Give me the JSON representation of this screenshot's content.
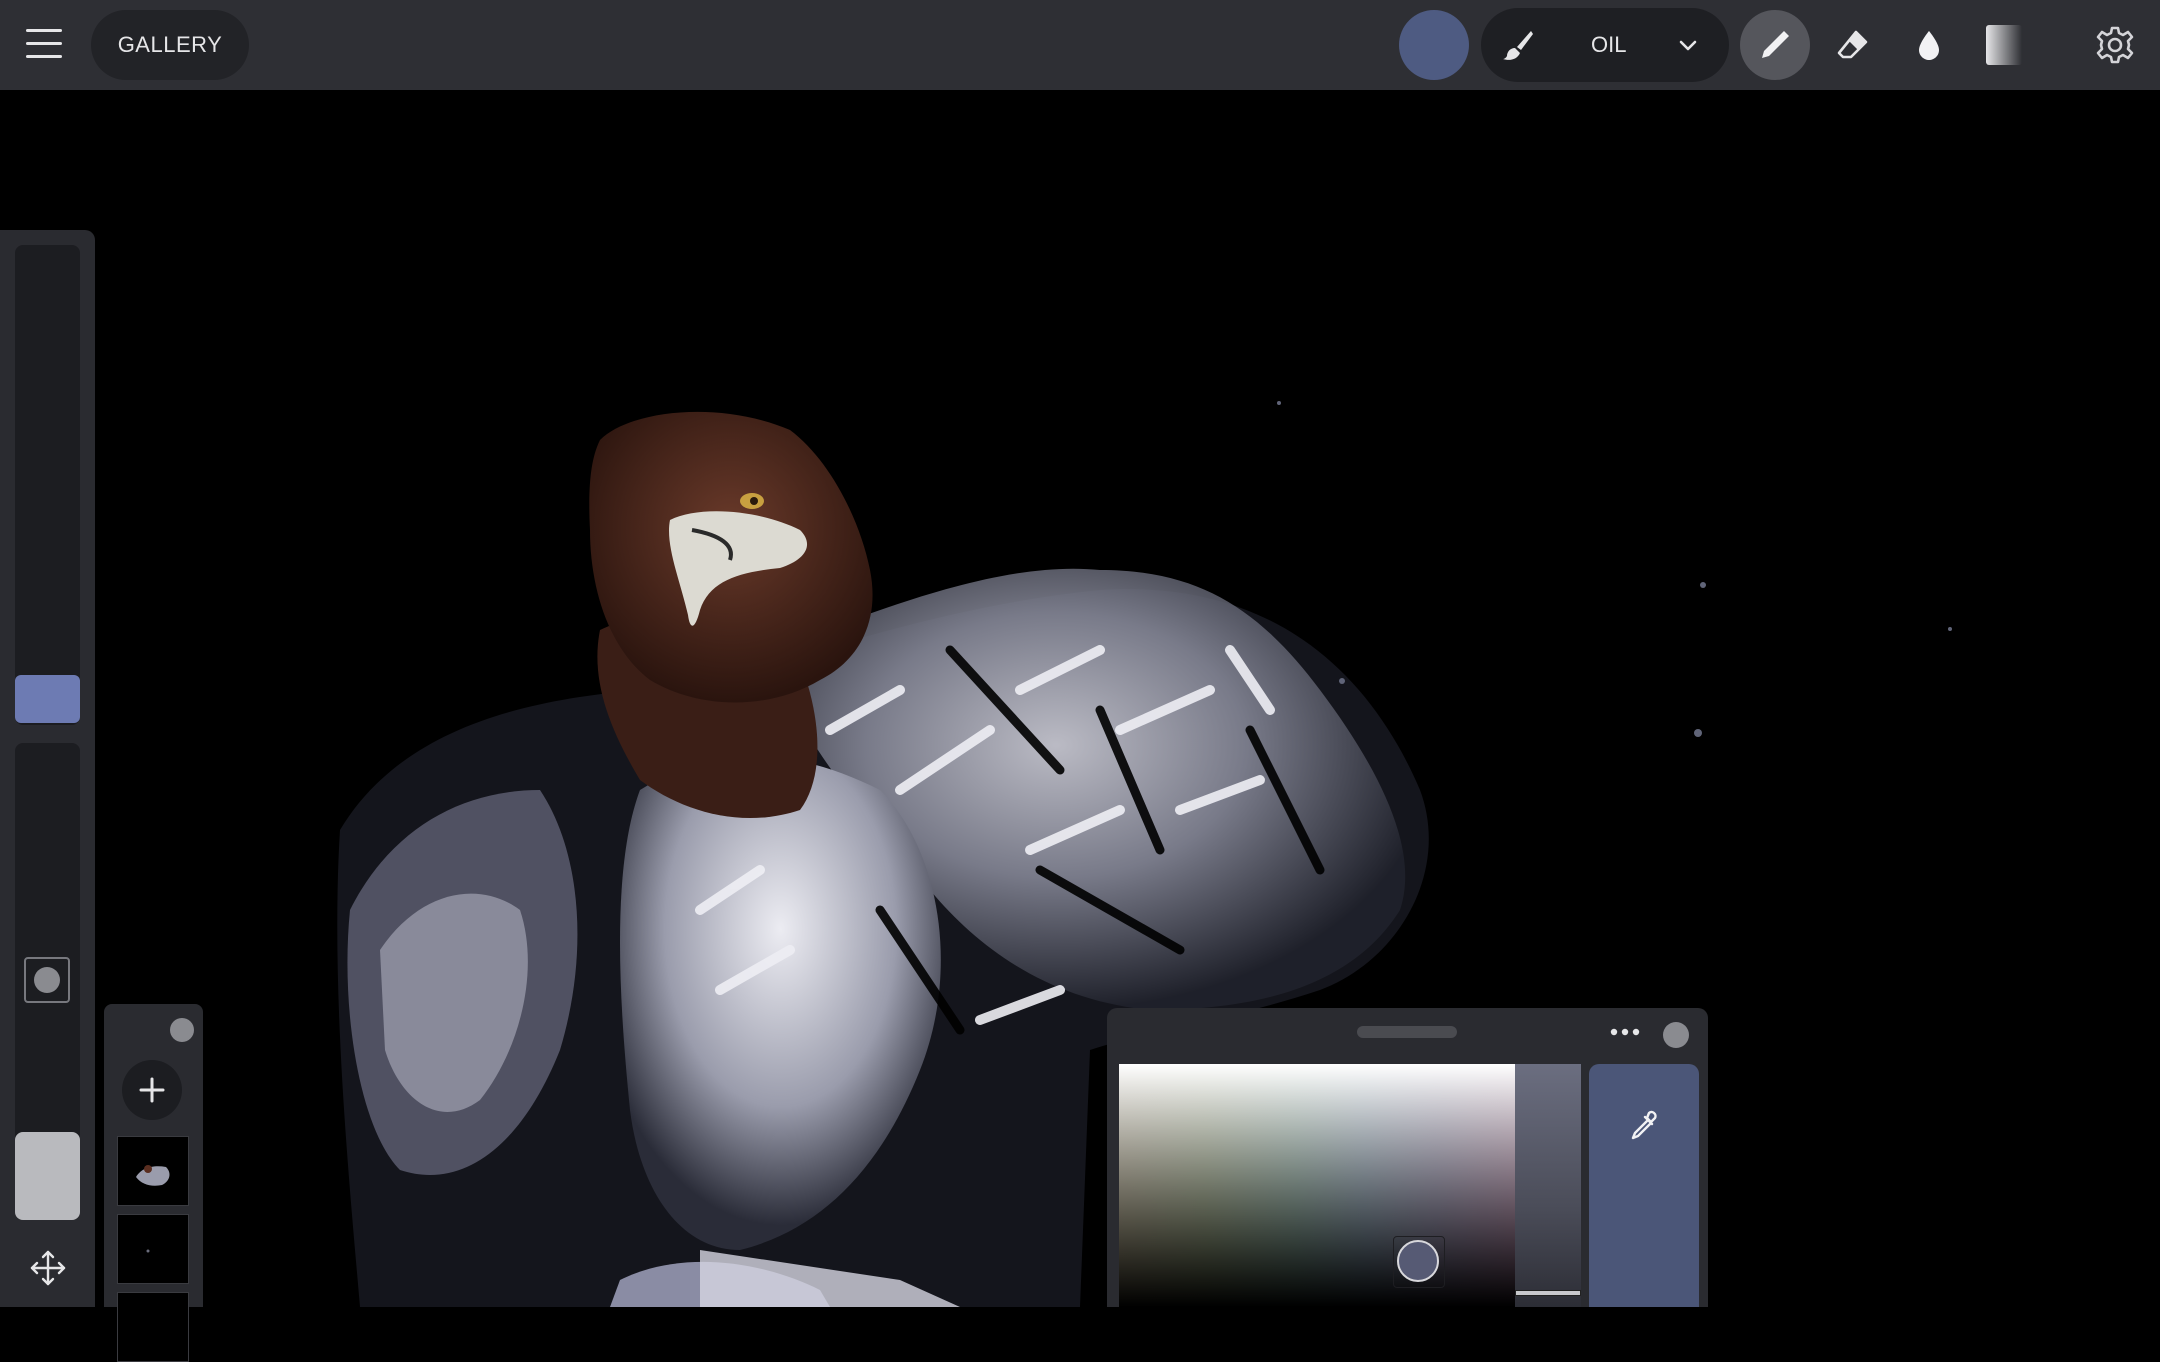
{
  "colors": {
    "accent": "#4e5b82",
    "size_thumb": "#6d7bb3",
    "eyedropper_bg": "#4b5678"
  },
  "topbar": {
    "menu_icon": "hamburger-menu-icon",
    "gallery_label": "GALLERY",
    "brush": {
      "icon": "paintbrush-icon",
      "name": "OIL",
      "dropdown_icon": "chevron-down-icon"
    },
    "tools": [
      "pencil-icon",
      "eraser-icon",
      "smudge-drop-icon",
      "gradient-icon"
    ],
    "active_tool": "pencil-icon",
    "settings_icon": "gear-icon"
  },
  "left_panel": {
    "size_level": 0.05,
    "opacity_level": 1.0,
    "move_icon": "move-arrows-icon"
  },
  "layers": {
    "add_icon": "plus-icon",
    "thumbnails": [
      "layer-1-thumbnail",
      "layer-2-thumbnail",
      "layer-3-thumbnail"
    ]
  },
  "color_panel": {
    "more_icon": "more-dots-icon",
    "eyedropper_icon": "eyedropper-icon"
  },
  "canvas": {
    "subject": "painting-canvas"
  }
}
